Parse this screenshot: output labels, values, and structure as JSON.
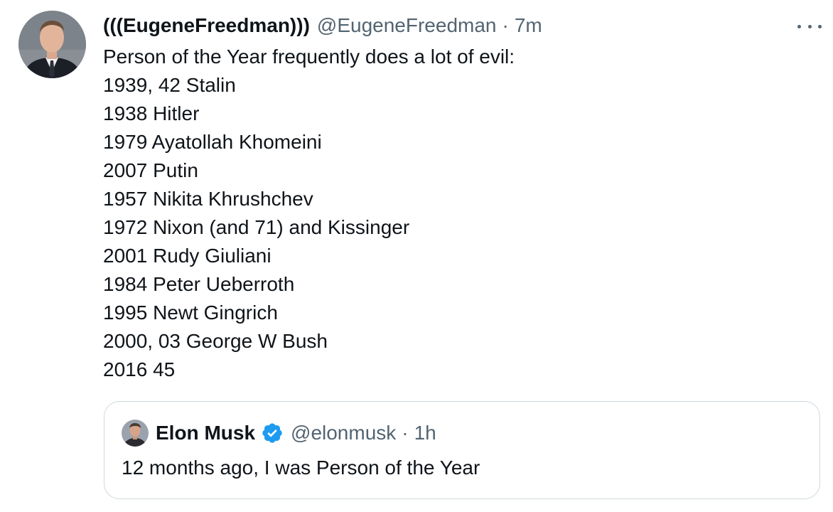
{
  "tweet": {
    "display_name": "(((EugeneFreedman)))",
    "handle": "@EugeneFreedman",
    "separator": "·",
    "time": "7m",
    "lines": [
      "Person of the Year frequently does a lot of evil:",
      "1939, 42 Stalin",
      "1938 Hitler",
      "1979 Ayatollah Khomeini",
      "2007 Putin",
      "1957 Nikita Khrushchev",
      "1972 Nixon (and 71) and Kissinger",
      "2001 Rudy Giuliani",
      "1984 Peter Ueberroth",
      "1995 Newt Gingrich",
      "2000, 03 George W Bush",
      "2016 45"
    ]
  },
  "quote": {
    "display_name": "Elon Musk",
    "handle": "@elonmusk",
    "separator": "·",
    "time": "1h",
    "text": "12 months ago, I was Person of the Year"
  },
  "icons": {
    "more": "more-horizontal-icon",
    "verified": "verified-badge-icon"
  },
  "colors": {
    "text": "#0f1419",
    "secondary": "#536471",
    "border": "#cfd9de",
    "verified": "#1d9bf0"
  }
}
